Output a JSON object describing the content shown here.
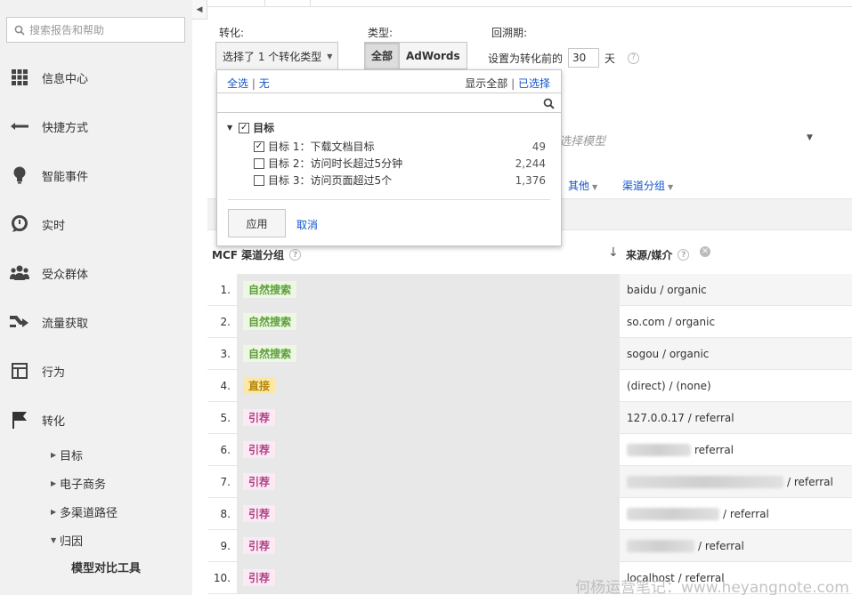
{
  "sidebar": {
    "search_placeholder": "搜索报告和帮助",
    "items": [
      {
        "label": "信息中心",
        "icon": "dashboard-grid-icon"
      },
      {
        "label": "快捷方式",
        "icon": "shortcut-arrow-icon"
      },
      {
        "label": "智能事件",
        "icon": "lightbulb-icon"
      },
      {
        "label": "实时",
        "icon": "realtime-icon"
      },
      {
        "label": "受众群体",
        "icon": "audience-icon"
      },
      {
        "label": "流量获取",
        "icon": "acquisition-icon"
      },
      {
        "label": "行为",
        "icon": "behavior-icon"
      },
      {
        "label": "转化",
        "icon": "flag-icon"
      }
    ],
    "sub_items": [
      "目标",
      "电子商务",
      "多渠道路径",
      "归因"
    ],
    "sub_sub_item": "模型对比工具"
  },
  "controls": {
    "conversion_label": "转化:",
    "conversion_dropdown": "选择了 1 个转化类型",
    "type_label": "类型:",
    "type_all": "全部",
    "type_adwords": "AdWords",
    "lookback_label": "回溯期:",
    "lookback_prefix": "设置为转化前的",
    "lookback_value": "30",
    "lookback_suffix": "天"
  },
  "background": {
    "model_placeholder": "选择模型",
    "dim_other": "其他",
    "dim_channel": "渠道分组"
  },
  "popover": {
    "select_all": "全选",
    "select_none": "无",
    "show_all": "显示全部",
    "selected": "已选择",
    "root_label": "目标",
    "goals": [
      {
        "label": "目标 1：下载文档目标",
        "count": "49",
        "checked": true
      },
      {
        "label": "目标 2：访问时长超过5分钟",
        "count": "2,244",
        "checked": false
      },
      {
        "label": "目标 3：访问页面超过5个",
        "count": "1,376",
        "checked": false
      }
    ],
    "apply": "应用",
    "cancel": "取消"
  },
  "table": {
    "col_a": "MCF 渠道分组",
    "col_b": "来源/媒介",
    "rows": [
      {
        "num": "1.",
        "channel": "自然搜索",
        "type": "organic",
        "source": "baidu / organic"
      },
      {
        "num": "2.",
        "channel": "自然搜索",
        "type": "organic",
        "source": "so.com / organic"
      },
      {
        "num": "3.",
        "channel": "自然搜索",
        "type": "organic",
        "source": "sogou / organic"
      },
      {
        "num": "4.",
        "channel": "直接",
        "type": "direct",
        "source": "(direct) / (none)"
      },
      {
        "num": "5.",
        "channel": "引荐",
        "type": "referral",
        "source": "127.0.0.17 / referral"
      },
      {
        "num": "6.",
        "channel": "引荐",
        "type": "referral",
        "source": "referral"
      },
      {
        "num": "7.",
        "channel": "引荐",
        "type": "referral",
        "source": "/ referral"
      },
      {
        "num": "8.",
        "channel": "引荐",
        "type": "referral",
        "source": "/ referral"
      },
      {
        "num": "9.",
        "channel": "引荐",
        "type": "referral",
        "source": "/ referral"
      },
      {
        "num": "10.",
        "channel": "引荐",
        "type": "referral",
        "source": "localhost / referral"
      }
    ]
  },
  "watermark": "何杨运营笔记：www.heyangnote.com"
}
